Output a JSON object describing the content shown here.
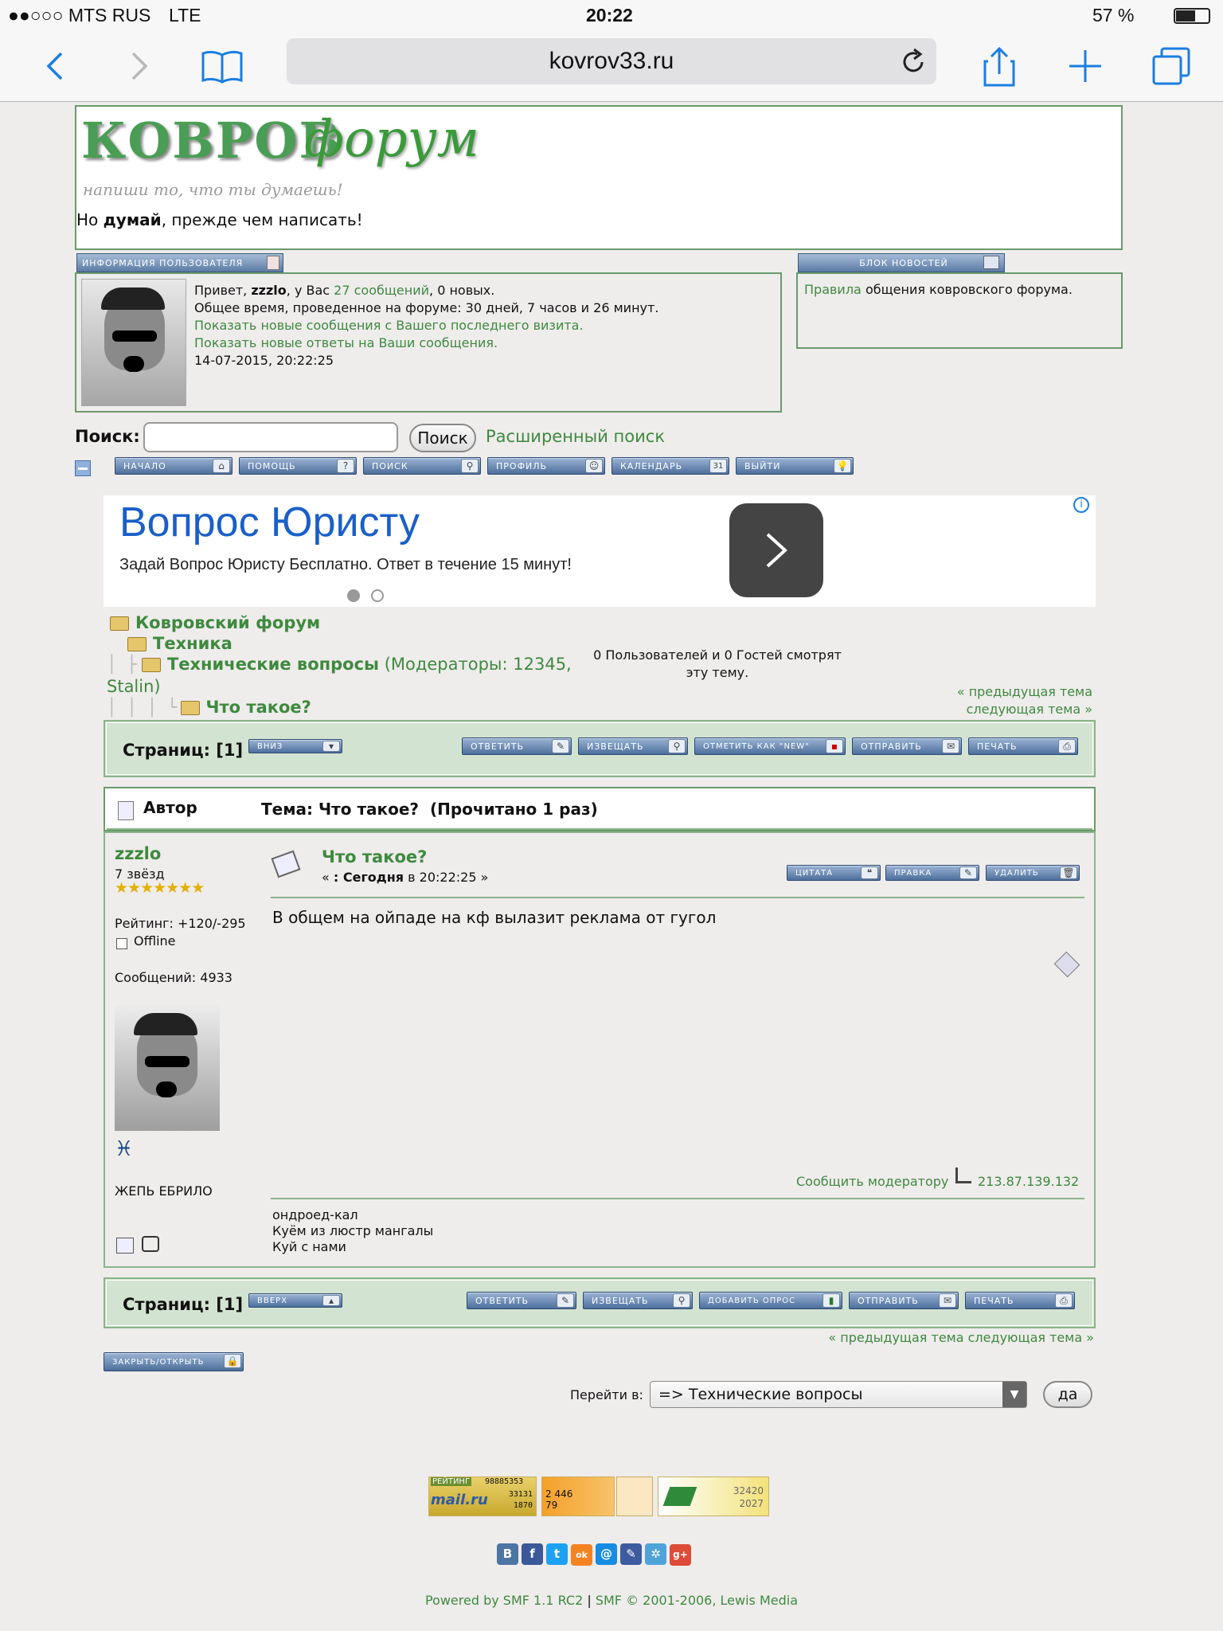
{
  "status": {
    "carrier": "●●○○○ MTS RUS",
    "network": "LTE",
    "time": "20:22",
    "battery": "57 %"
  },
  "browser": {
    "url": "kovrov33.ru"
  },
  "header": {
    "logo_main": "КОВРОВ",
    "logo_script": "форум",
    "logo_tagline": "напиши то, что ты думаешь!",
    "slogan_pre": "Но ",
    "slogan_bold": "думай",
    "slogan_post": ", прежде чем написать!"
  },
  "userinfo": {
    "tab": "ИНФОРМАЦИЯ ПОЛЬЗОВАТЕЛЯ",
    "greeting_pre": "Привет, ",
    "username": "zzzlo",
    "greeting_mid": ", у Вас ",
    "messages_link": "27 сообщений",
    "greeting_post": ", 0 новых.",
    "time_online": "Общее время, проведенное на форуме: 30 дней, 7 часов и 26 минут.",
    "new_since_link": "Показать новые сообщения с Вашего последнего визита.",
    "new_replies_link": "Показать новые ответы на Ваши сообщения.",
    "datetime": "14-07-2015, 20:22:25"
  },
  "news": {
    "tab": "БЛОК НОВОСТЕЙ",
    "rules_link": "Правила",
    "rules_text": " общения ковровского форума."
  },
  "search": {
    "label": "Поиск:",
    "button": "Поиск",
    "advanced": "Расширенный поиск",
    "value": ""
  },
  "menu": [
    "НАЧАЛО",
    "ПОМОЩЬ",
    "ПОИСК",
    "ПРОФИЛЬ",
    "КАЛЕНДАРЬ",
    "ВЫЙТИ"
  ],
  "ad": {
    "title": "Вопрос Юристу",
    "subtitle": "Задай Вопрос Юристу Бесплатно. Ответ в течение 15 минут!"
  },
  "breadcrumb": {
    "root": "Ковровский форум",
    "l1": "Техника",
    "l2": "Технические вопросы",
    "moderators": " (Модераторы: 12345,",
    "moderators2": "Stalin)",
    "l3": "Что такое?"
  },
  "viewers": "0 Пользователей и 0 Гостей смотрят эту тему.",
  "prevnext": "« предыдущая тема следующая тема »",
  "topbar": {
    "pages": "Страниц: [1]",
    "down": "ВНИЗ",
    "buttons": [
      "ОТВЕТИТЬ",
      "ИЗВЕЩАТЬ",
      "ОТМЕТИТЬ КАК \"NEW\"",
      "ОТПРАВИТЬ",
      "ПЕЧАТЬ"
    ]
  },
  "topic": {
    "author_hdr": "Автор",
    "title": "Тема: Что такое?  (Прочитано 1 раз)"
  },
  "post": {
    "author": "zzzlo",
    "rank": "7 звёзд",
    "stars": "★★★★★★★",
    "rating": "Рейтинг: +120/-295",
    "status": "Offline",
    "msgs": "Сообщений: 4933",
    "zodiac": "♓",
    "signature_name": "ЖЕПЬ ЕБРИЛО",
    "subject": "Что такое?",
    "date_pre": "« ",
    "date_bold": ": Сегодня",
    "date_post": " в 20:22:25 »",
    "buttons": [
      "ЦИТАТА",
      "ПРАВКА",
      "УДАЛИТЬ"
    ],
    "body": "В общем на ойпаде на кф вылазит реклама от гугол",
    "report": "Сообщить модератору",
    "ip": "213.87.139.132",
    "sig": [
      "ондроед-кал",
      "Куём из люстр мангалы",
      "Куй с нами"
    ]
  },
  "bottombar": {
    "pages": "Страниц: [1]",
    "up": "ВВЕРХ",
    "buttons": [
      "ОТВЕТИТЬ",
      "ИЗВЕЩАТЬ",
      "ДОБАВИТЬ ОПРОС",
      "ОТПРАВИТЬ",
      "ПЕЧАТЬ"
    ]
  },
  "lock_button": "ЗАКРЫТЬ/ОТКРЫТЬ",
  "jump": {
    "label": "Перейти в:",
    "selected": "=> Технические вопросы",
    "go": "да"
  },
  "counters": {
    "mail_label": "РЕЙТИНГ",
    "mail_a": "98885353",
    "mail_b": "33131",
    "mail_c": "1870",
    "mail_brand": "mail.ru",
    "li_a": "2 446",
    "li_b": "79",
    "c3_a": "32420",
    "c3_b": "2027"
  },
  "social": [
    "В",
    "f",
    "t",
    "ok",
    "@",
    "✎",
    "✲",
    "g+"
  ],
  "footer": {
    "smf": "Powered by SMF 1.1 RC2",
    "sep": " | ",
    "copy": "SMF © 2001-2006, Lewis Media"
  }
}
